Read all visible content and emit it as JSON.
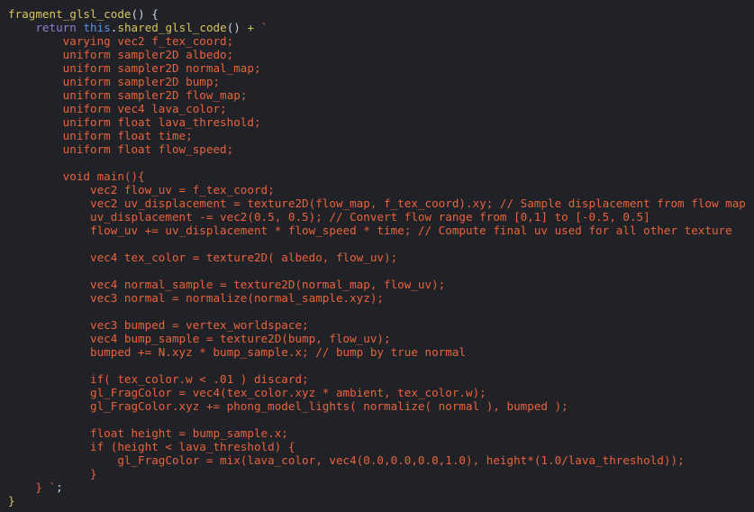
{
  "editor": {
    "theme": "dark",
    "language": "javascript",
    "background_color": "#212228",
    "string_color": "#e8623a",
    "function_color": "#d6c55a",
    "keyword_color": "#8a7fd4",
    "this_color": "#5b8fe0",
    "operator_color": "#c2c94a",
    "punct_color": "#cfd2dd"
  },
  "lines": [
    {
      "id": "line-1",
      "tokens": [
        {
          "text": "fragment_glsl_code",
          "cls": "t-fn"
        },
        {
          "text": "() {",
          "cls": "t-punct"
        }
      ]
    },
    {
      "id": "line-2",
      "tokens": [
        {
          "text": "    ",
          "cls": "t-punct"
        },
        {
          "text": "return",
          "cls": "t-kw"
        },
        {
          "text": " ",
          "cls": "t-punct"
        },
        {
          "text": "this",
          "cls": "t-this"
        },
        {
          "text": ".",
          "cls": "t-punct"
        },
        {
          "text": "shared_glsl_code",
          "cls": "t-fn"
        },
        {
          "text": "()",
          "cls": "t-punct"
        },
        {
          "text": " + ",
          "cls": "t-op"
        },
        {
          "text": "`",
          "cls": "t-tick"
        }
      ]
    },
    {
      "id": "line-3",
      "tokens": [
        {
          "text": "        varying vec2 f_tex_coord;",
          "cls": "t-str"
        }
      ]
    },
    {
      "id": "line-4",
      "tokens": [
        {
          "text": "        uniform sampler2D albedo;",
          "cls": "t-str"
        }
      ]
    },
    {
      "id": "line-5",
      "tokens": [
        {
          "text": "        uniform sampler2D normal_map;",
          "cls": "t-str"
        }
      ]
    },
    {
      "id": "line-6",
      "tokens": [
        {
          "text": "        uniform sampler2D bump;",
          "cls": "t-str"
        }
      ]
    },
    {
      "id": "line-7",
      "tokens": [
        {
          "text": "        uniform sampler2D flow_map;",
          "cls": "t-str"
        }
      ]
    },
    {
      "id": "line-8",
      "tokens": [
        {
          "text": "        uniform vec4 lava_color;",
          "cls": "t-str"
        }
      ]
    },
    {
      "id": "line-9",
      "tokens": [
        {
          "text": "        uniform float lava_threshold;",
          "cls": "t-str"
        }
      ]
    },
    {
      "id": "line-10",
      "tokens": [
        {
          "text": "        uniform float time;",
          "cls": "t-str"
        }
      ]
    },
    {
      "id": "line-11",
      "tokens": [
        {
          "text": "        uniform float flow_speed;",
          "cls": "t-str"
        }
      ]
    },
    {
      "id": "line-12",
      "tokens": [
        {
          "text": "",
          "cls": "t-str"
        }
      ]
    },
    {
      "id": "line-13",
      "tokens": [
        {
          "text": "        void main(){",
          "cls": "t-str"
        }
      ]
    },
    {
      "id": "line-14",
      "tokens": [
        {
          "text": "            vec2 flow_uv = f_tex_coord;",
          "cls": "t-str"
        }
      ]
    },
    {
      "id": "line-15",
      "tokens": [
        {
          "text": "            vec2 uv_displacement = texture2D(flow_map, f_tex_coord).xy; // Sample displacement from flow map",
          "cls": "t-str"
        }
      ]
    },
    {
      "id": "line-16",
      "tokens": [
        {
          "text": "            uv_displacement -= vec2(0.5, 0.5); // Convert flow range from [0,1] to [-0.5, 0.5]",
          "cls": "t-str"
        }
      ]
    },
    {
      "id": "line-17",
      "tokens": [
        {
          "text": "            flow_uv += uv_displacement * flow_speed * time; // Compute final uv used for all other texture",
          "cls": "t-str"
        }
      ]
    },
    {
      "id": "line-18",
      "tokens": [
        {
          "text": "",
          "cls": "t-str"
        }
      ]
    },
    {
      "id": "line-19",
      "tokens": [
        {
          "text": "            vec4 tex_color = texture2D( albedo, flow_uv);",
          "cls": "t-str"
        }
      ]
    },
    {
      "id": "line-20",
      "tokens": [
        {
          "text": "",
          "cls": "t-str"
        }
      ]
    },
    {
      "id": "line-21",
      "tokens": [
        {
          "text": "            vec4 normal_sample = texture2D(normal_map, flow_uv);",
          "cls": "t-str"
        }
      ]
    },
    {
      "id": "line-22",
      "tokens": [
        {
          "text": "            vec3 normal = normalize(normal_sample.xyz);",
          "cls": "t-str"
        }
      ]
    },
    {
      "id": "line-23",
      "tokens": [
        {
          "text": "",
          "cls": "t-str"
        }
      ]
    },
    {
      "id": "line-24",
      "tokens": [
        {
          "text": "            vec3 bumped = vertex_worldspace;",
          "cls": "t-str"
        }
      ]
    },
    {
      "id": "line-25",
      "tokens": [
        {
          "text": "            vec4 bump_sample = texture2D(bump, flow_uv);",
          "cls": "t-str"
        }
      ]
    },
    {
      "id": "line-26",
      "tokens": [
        {
          "text": "            bumped += N.xyz * bump_sample.x; // bump by true normal",
          "cls": "t-str"
        }
      ]
    },
    {
      "id": "line-27",
      "tokens": [
        {
          "text": "",
          "cls": "t-str"
        }
      ]
    },
    {
      "id": "line-28",
      "tokens": [
        {
          "text": "            if( tex_color.w < .01 ) discard;",
          "cls": "t-str"
        }
      ]
    },
    {
      "id": "line-29",
      "tokens": [
        {
          "text": "            gl_FragColor = vec4(tex_color.xyz * ambient, tex_color.w);",
          "cls": "t-str"
        }
      ]
    },
    {
      "id": "line-30",
      "tokens": [
        {
          "text": "            gl_FragColor.xyz += phong_model_lights( normalize( normal ), bumped );",
          "cls": "t-str"
        }
      ]
    },
    {
      "id": "line-31",
      "tokens": [
        {
          "text": "",
          "cls": "t-str"
        }
      ]
    },
    {
      "id": "line-32",
      "tokens": [
        {
          "text": "            float height = bump_sample.x;",
          "cls": "t-str"
        }
      ]
    },
    {
      "id": "line-33",
      "tokens": [
        {
          "text": "            if (height < lava_threshold) {",
          "cls": "t-str"
        }
      ]
    },
    {
      "id": "line-34",
      "tokens": [
        {
          "text": "                gl_FragColor = mix(lava_color, vec4(0.0,0.0,0.0,1.0), height*(1.0/lava_threshold));",
          "cls": "t-str"
        }
      ]
    },
    {
      "id": "line-35",
      "tokens": [
        {
          "text": "            }",
          "cls": "t-str"
        }
      ]
    },
    {
      "id": "line-36",
      "tokens": [
        {
          "text": "    } ",
          "cls": "t-str"
        },
        {
          "text": "`",
          "cls": "t-tick"
        },
        {
          "text": ";",
          "cls": "t-semi"
        }
      ]
    },
    {
      "id": "line-37",
      "tokens": [
        {
          "text": "}",
          "cls": "t-brace"
        }
      ]
    }
  ]
}
